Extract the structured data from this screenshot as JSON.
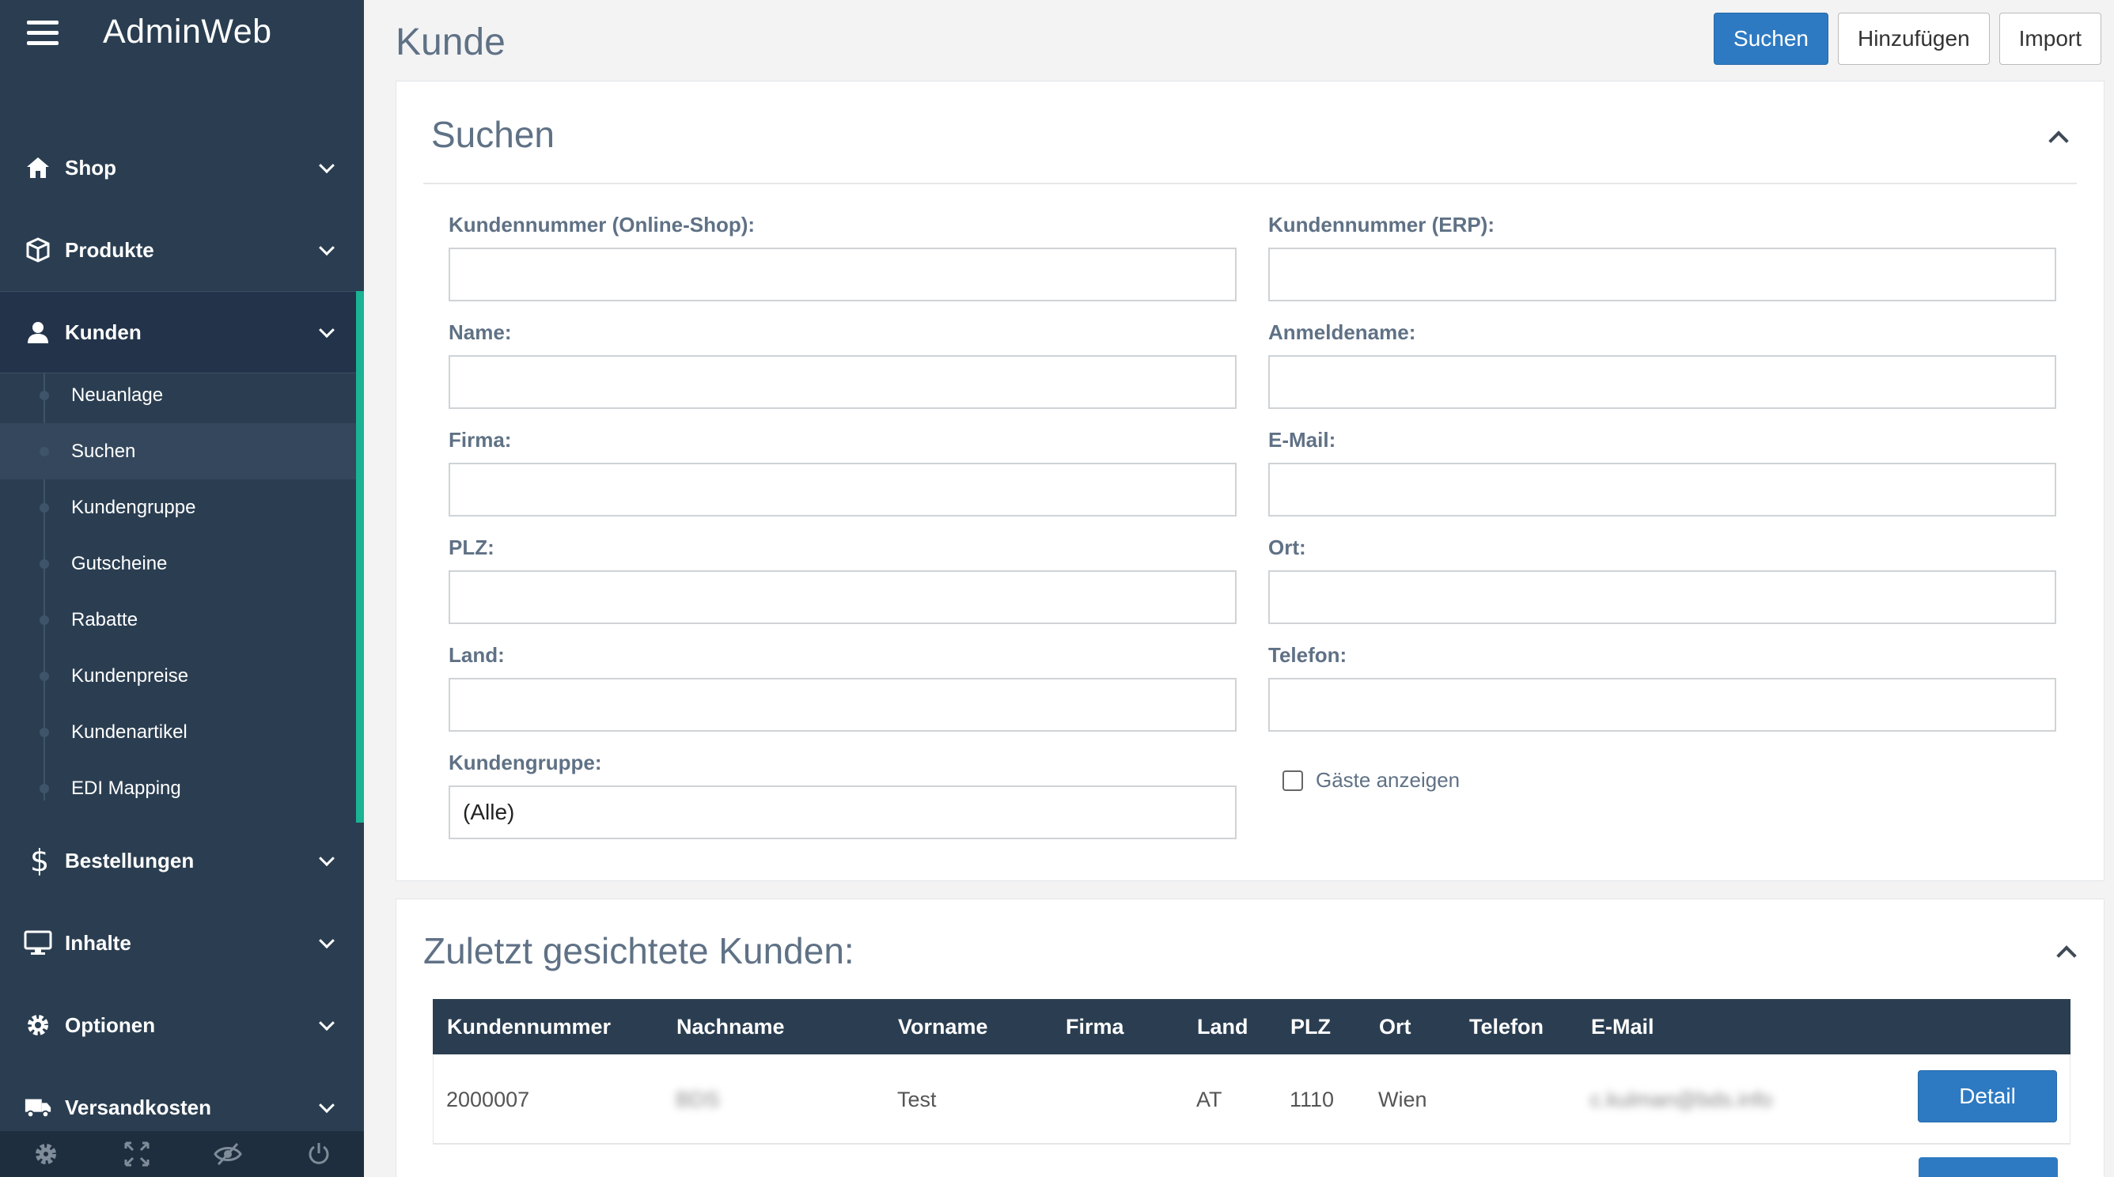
{
  "app": {
    "title": "AdminWeb"
  },
  "sidebar": {
    "items": [
      {
        "label": "Shop",
        "icon": "home-icon"
      },
      {
        "label": "Produkte",
        "icon": "box-icon"
      },
      {
        "label": "Kunden",
        "icon": "user-icon",
        "expanded": true
      },
      {
        "label": "Bestellungen",
        "icon": "dollar-icon"
      },
      {
        "label": "Inhalte",
        "icon": "monitor-icon"
      },
      {
        "label": "Optionen",
        "icon": "gear-icon"
      },
      {
        "label": "Versandkosten",
        "icon": "truck-icon"
      }
    ],
    "subitems": [
      {
        "label": "Neuanlage"
      },
      {
        "label": "Suchen",
        "current": true
      },
      {
        "label": "Kundengruppe"
      },
      {
        "label": "Gutscheine"
      },
      {
        "label": "Rabatte"
      },
      {
        "label": "Kundenpreise"
      },
      {
        "label": "Kundenartikel"
      },
      {
        "label": "EDI Mapping"
      }
    ],
    "footer_icons": [
      "settings-icon",
      "fullscreen-icon",
      "hide-icon",
      "power-icon"
    ]
  },
  "header": {
    "title": "Kunde",
    "buttons": {
      "search": "Suchen",
      "add": "Hinzufügen",
      "import": "Import"
    }
  },
  "search_panel": {
    "title": "Suchen",
    "fields": {
      "customer_no_shop": {
        "label": "Kundennummer (Online-Shop):",
        "value": ""
      },
      "customer_no_erp": {
        "label": "Kundennummer (ERP):",
        "value": ""
      },
      "name": {
        "label": "Name:",
        "value": ""
      },
      "login_name": {
        "label": "Anmeldename:",
        "value": ""
      },
      "company": {
        "label": "Firma:",
        "value": ""
      },
      "email": {
        "label": "E-Mail:",
        "value": ""
      },
      "zip": {
        "label": "PLZ:",
        "value": ""
      },
      "city": {
        "label": "Ort:",
        "value": ""
      },
      "country": {
        "label": "Land:",
        "value": ""
      },
      "phone": {
        "label": "Telefon:",
        "value": ""
      },
      "customer_group": {
        "label": "Kundengruppe:",
        "value": "(Alle)"
      }
    },
    "show_guests": {
      "label": "Gäste anzeigen",
      "checked": false
    }
  },
  "recent_panel": {
    "title": "Zuletzt gesichtete Kunden:",
    "columns": [
      "Kundennummer",
      "Nachname",
      "Vorname",
      "Firma",
      "Land",
      "PLZ",
      "Ort",
      "Telefon",
      "E-Mail"
    ],
    "rows": [
      {
        "Kundennummer": "2000007",
        "Nachname": "BDS",
        "Vorname": "Test",
        "Firma": "",
        "Land": "AT",
        "PLZ": "1110",
        "Ort": "Wien",
        "Telefon": "",
        "E-Mail": "c.kulman@bds.info",
        "button": "Detail"
      }
    ]
  }
}
